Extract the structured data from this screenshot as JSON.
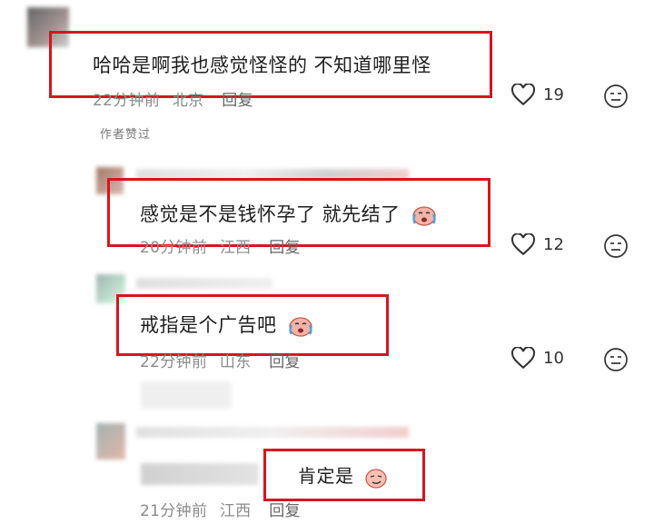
{
  "colors": {
    "highlight_box": "#d8141f",
    "meta_text": "#8b8b8b",
    "main_text": "#1e1e1e"
  },
  "comments": [
    {
      "text": "哈哈是啊我也感觉怪怪的 不知道哪里怪",
      "time": "22分钟前",
      "location": "北京",
      "reply": "回复",
      "likes": "19",
      "tag": "作者赞过"
    },
    {
      "text": "感觉是不是钱怀孕了 就先结了",
      "emoji": "crying-face-emoji",
      "time": "20分钟前",
      "location": "江西",
      "reply": "回复",
      "likes": "12"
    },
    {
      "text": "戒指是个广告吧",
      "emoji": "crying-face-emoji",
      "time": "22分钟前",
      "location": "山东",
      "reply": "回复",
      "likes": "10"
    },
    {
      "text": "肯定是",
      "emoji": "smirk-face-emoji",
      "time": "21分钟前",
      "location": "江西",
      "reply": "回复"
    }
  ]
}
